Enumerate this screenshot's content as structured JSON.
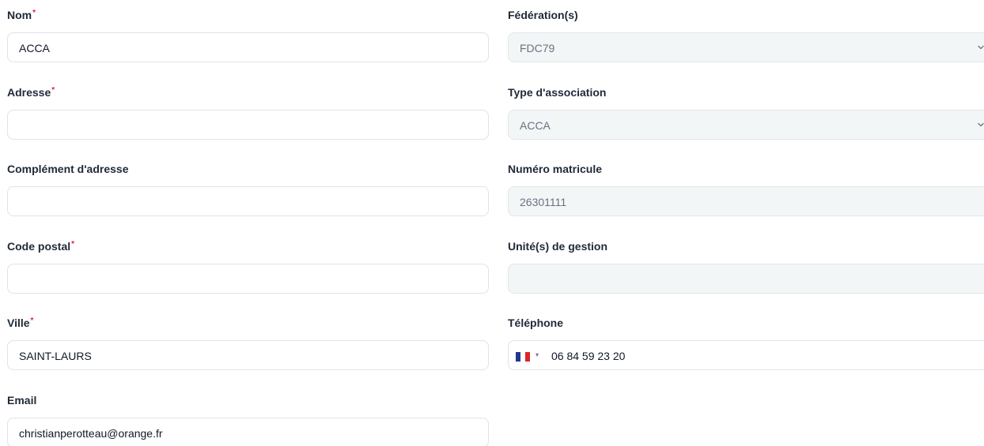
{
  "form": {
    "nom": {
      "label": "Nom",
      "required_mark": "*",
      "value": "ACCA"
    },
    "adresse": {
      "label": "Adresse",
      "required_mark": "*",
      "value": ""
    },
    "complement": {
      "label": "Complément d'adresse",
      "value": ""
    },
    "code_postal": {
      "label": "Code postal",
      "required_mark": "*",
      "value": ""
    },
    "ville": {
      "label": "Ville",
      "required_mark": "*",
      "value": "SAINT-LAURS"
    },
    "email": {
      "label": "Email",
      "value": "christianperotteau@orange.fr"
    },
    "federation": {
      "label": "Fédération(s)",
      "value": "FDC79"
    },
    "type_association": {
      "label": "Type d'association",
      "value": "ACCA"
    },
    "numero_matricule": {
      "label": "Numéro matricule",
      "value": "26301111"
    },
    "unite_gestion": {
      "label": "Unité(s) de gestion",
      "value": ""
    },
    "telephone": {
      "label": "Téléphone",
      "flag_icon": "france-flag-icon",
      "flag_colors": [
        "#1e3a8a",
        "#ffffff",
        "#dc2626"
      ],
      "caret": "▾",
      "value": "06 84 59 23 20"
    }
  },
  "icons": {
    "select_chevron": "chevron-down-icon"
  }
}
